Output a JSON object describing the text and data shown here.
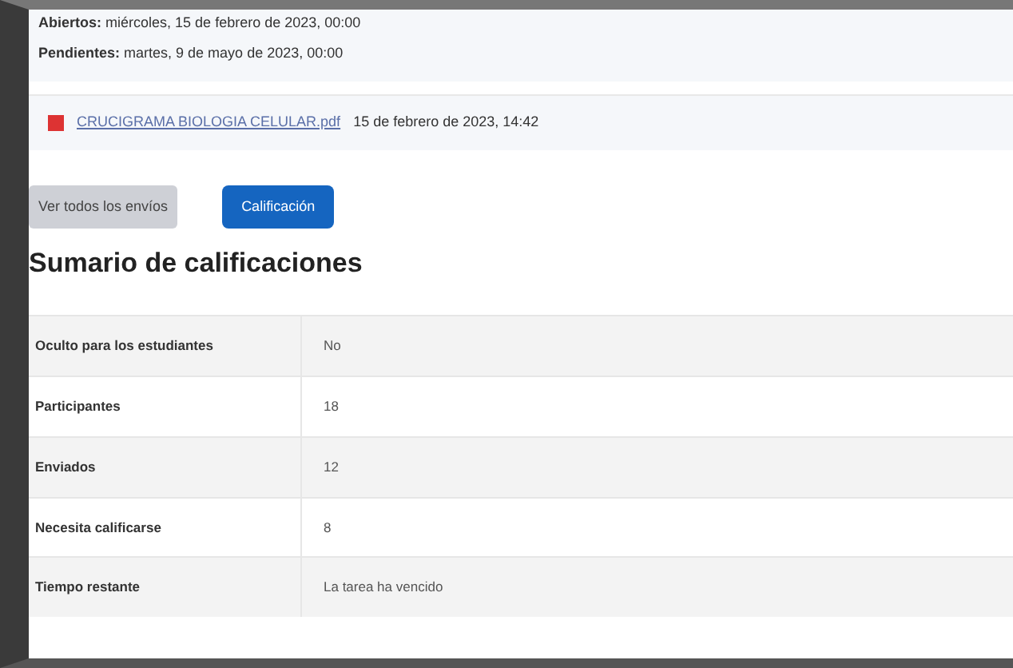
{
  "dates": [
    {
      "label": "Abiertos:",
      "value": "miércoles, 15 de febrero de 2023, 00:00"
    },
    {
      "label": "Pendientes:",
      "value": "martes, 9 de mayo de 2023, 00:00"
    }
  ],
  "file": {
    "name": "CRUCIGRAMA BIOLOGIA CELULAR.pdf",
    "date": "15 de febrero de 2023, 14:42"
  },
  "buttons": [
    {
      "label": "Ver todos los envíos",
      "kind": "secondary"
    },
    {
      "label": "Calificación",
      "kind": "primary"
    }
  ],
  "heading": "Sumario de calificaciones",
  "table": {
    "rows": [
      {
        "label": "Oculto para los estudiantes",
        "value": "No"
      },
      {
        "label": "Participantes",
        "value": "18"
      },
      {
        "label": "Enviados",
        "value": "12"
      },
      {
        "label": "Necesita calificarse",
        "value": "8"
      },
      {
        "label": "Tiempo restante",
        "value": "La tarea ha vencido"
      }
    ]
  }
}
